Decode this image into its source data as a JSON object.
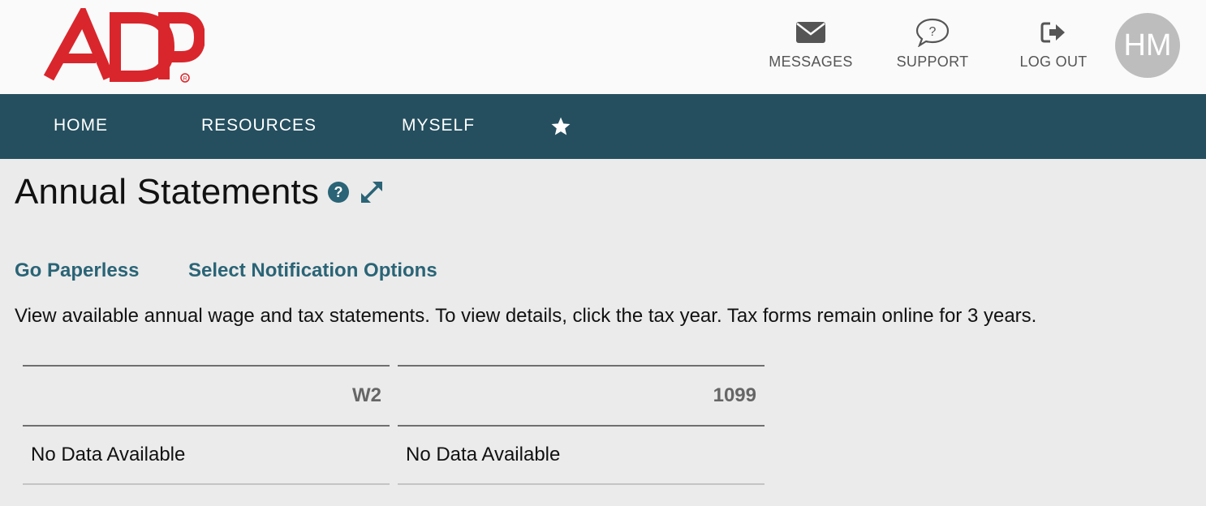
{
  "header": {
    "logo_text": "ADP",
    "items": {
      "messages": {
        "label": "MESSAGES",
        "icon": "envelope-icon"
      },
      "support": {
        "label": "SUPPORT",
        "icon": "speech-bubble-question-icon"
      },
      "logout": {
        "label": "LOG OUT",
        "icon": "sign-out-icon"
      }
    },
    "avatar_initials": "HM"
  },
  "nav": {
    "items": [
      "HOME",
      "RESOURCES",
      "MYSELF"
    ],
    "favorites_icon": "star-icon"
  },
  "page": {
    "title": "Annual Statements",
    "help_icon": "question-circle-icon",
    "expand_icon": "expand-arrows-icon",
    "links": {
      "go_paperless": "Go Paperless",
      "notification_options": "Select Notification Options"
    },
    "description": "View available annual wage and tax statements. To view details, click the tax year. Tax forms remain online for 3 years."
  },
  "statements": {
    "columns": [
      {
        "header": "W2",
        "rows": [
          "No Data Available"
        ]
      },
      {
        "header": "1099",
        "rows": [
          "No Data Available"
        ]
      }
    ]
  },
  "colors": {
    "brand_red": "#d9262c",
    "nav_bg": "#254f5f",
    "link": "#2a6476",
    "page_bg": "#ebebeb"
  }
}
